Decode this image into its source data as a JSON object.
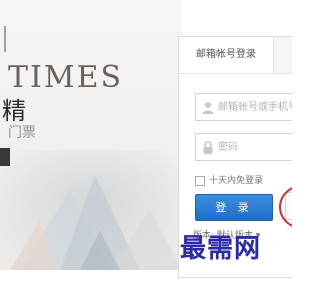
{
  "banner": {
    "brand_title": "TIMES",
    "brand_subtitle": "精",
    "brand_ticket": "门票"
  },
  "login": {
    "tab_label": "邮箱帐号登录",
    "username_placeholder": "邮箱帐号或手机号",
    "password_placeholder": "密码",
    "remember_label": "十天内免登录",
    "login_button": "登 录",
    "version_label": "版本: 默认版本 ▾"
  },
  "watermark": {
    "text": "最需网"
  },
  "icons": {
    "username": "user-icon",
    "password": "lock-icon",
    "remember": "checkbox"
  },
  "colors": {
    "primary_button": "#2a7fd4",
    "annotation_circle": "#c8323a",
    "watermark": "#2b2aa8"
  }
}
